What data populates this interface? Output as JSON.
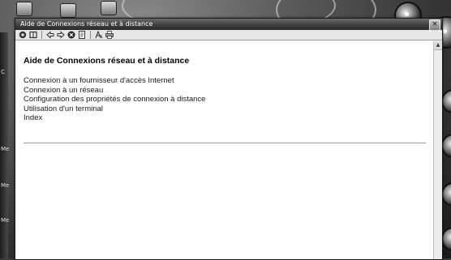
{
  "window": {
    "title": "Aide de Connexions réseau et à distance",
    "close_label": "×"
  },
  "toolbar": {
    "buttons": [
      "hide-icon",
      "locate-icon",
      "back-icon",
      "forward-icon",
      "stop-icon",
      "refresh-icon",
      "font-icon",
      "print-icon"
    ]
  },
  "content": {
    "heading": "Aide de Connexions réseau et à distance",
    "topics": [
      "Connexion à un fournisseur d'accès Internet",
      "Connexion à un réseau",
      "Configuration des propriétés de connexion à distance",
      "Utilisation d'un terminal",
      "Index"
    ]
  },
  "desktop": {
    "side_labels": [
      "C",
      "Me",
      "Me",
      "Me"
    ]
  },
  "colors": {
    "titlebar": "#3c3c3c",
    "window_bg": "#ffffff",
    "toolbar_bg": "#e6e6e6"
  }
}
